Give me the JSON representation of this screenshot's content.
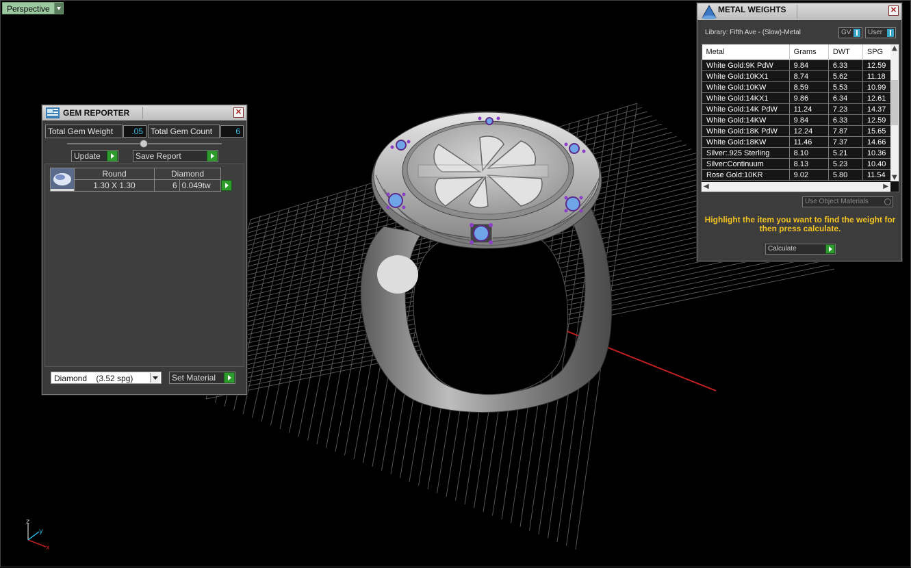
{
  "viewport": {
    "view_label": "Perspective"
  },
  "gem_reporter": {
    "title": "GEM REPORTER",
    "total_weight_label": "Total Gem Weight",
    "total_weight_value": ".05",
    "total_count_label": "Total Gem Count",
    "total_count_value": "6",
    "update_label": "Update",
    "save_report_label": "Save Report",
    "header_cut": "Round",
    "header_material": "Diamond",
    "row": {
      "size": "1.30 X 1.30",
      "count": "6",
      "weight": "0.049tw"
    },
    "material_select": "Diamond    (3.52 spg)",
    "set_material_label": "Set Material"
  },
  "metal_weights": {
    "title": "METAL WEIGHTS",
    "library": "Library: Fifth Ave - (Slow)-Metal",
    "gv_label": "GV",
    "user_label": "User",
    "columns": [
      "Metal",
      "Grams",
      "DWT",
      "SPG"
    ],
    "rows": [
      [
        "White Gold:9K PdW",
        "9.84",
        "6.33",
        "12.59"
      ],
      [
        "White Gold:10KX1",
        "8.74",
        "5.62",
        "11.18"
      ],
      [
        "White Gold:10KW",
        "8.59",
        "5.53",
        "10.99"
      ],
      [
        "White Gold:14KX1",
        "9.86",
        "6.34",
        "12.61"
      ],
      [
        "White Gold:14K PdW",
        "11.24",
        "7.23",
        "14.37"
      ],
      [
        "White Gold:14KW",
        "9.84",
        "6.33",
        "12.59"
      ],
      [
        "White Gold:18K PdW",
        "12.24",
        "7.87",
        "15.65"
      ],
      [
        "White Gold:18KW",
        "11.46",
        "7.37",
        "14.66"
      ],
      [
        "Silver:.925 Sterling",
        "8.10",
        "5.21",
        "10.36"
      ],
      [
        "Silver:Continuum",
        "8.13",
        "5.23",
        "10.40"
      ],
      [
        "Rose Gold:10KR",
        "9.02",
        "5.80",
        "11.54"
      ]
    ],
    "use_object_materials": "Use Object Materials",
    "hint": "Highlight the item you want to find the weight for then press calculate.",
    "calculate_label": "Calculate"
  },
  "axes": {
    "x": "x",
    "y": "y",
    "z": "z"
  }
}
